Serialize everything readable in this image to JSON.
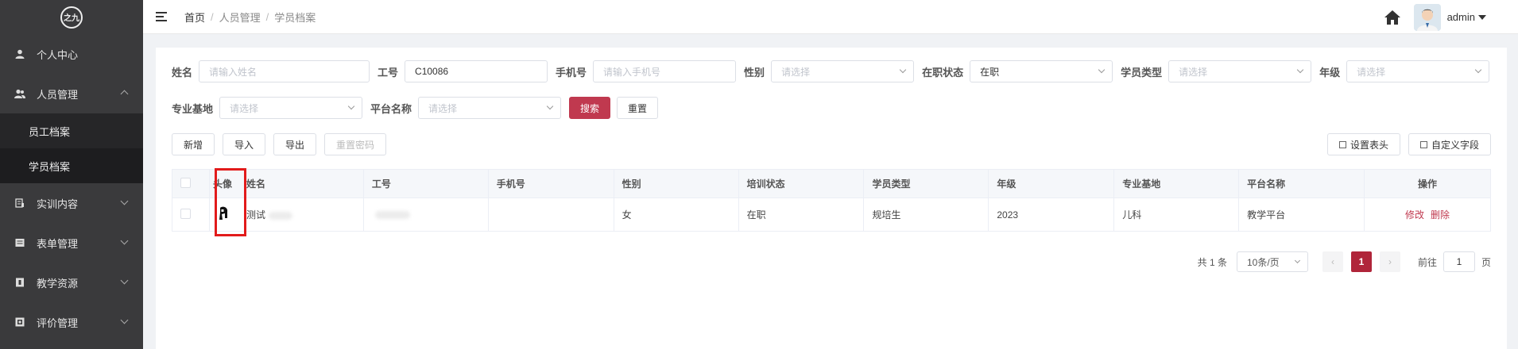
{
  "sidebar": {
    "logo_text": "之九",
    "items": [
      {
        "label": "个人中心"
      },
      {
        "label": "人员管理"
      },
      {
        "label": "实训内容"
      },
      {
        "label": "表单管理"
      },
      {
        "label": "教学资源"
      },
      {
        "label": "评价管理"
      }
    ],
    "sub_items": [
      {
        "label": "员工档案"
      },
      {
        "label": "学员档案"
      }
    ]
  },
  "header": {
    "breadcrumb": [
      "首页",
      "人员管理",
      "学员档案"
    ],
    "separator": "/",
    "username": "admin"
  },
  "filters": {
    "name": {
      "label": "姓名",
      "placeholder": "请输入姓名"
    },
    "emp_no": {
      "label": "工号",
      "value": "C10086"
    },
    "phone": {
      "label": "手机号",
      "placeholder": "请输入手机号"
    },
    "gender": {
      "label": "性别",
      "placeholder": "请选择"
    },
    "status": {
      "label": "在职状态",
      "value": "在职"
    },
    "student_type": {
      "label": "学员类型",
      "placeholder": "请选择"
    },
    "grade": {
      "label": "年级",
      "placeholder": "请选择"
    },
    "base": {
      "label": "专业基地",
      "placeholder": "请选择"
    },
    "platform": {
      "label": "平台名称",
      "placeholder": "请选择"
    },
    "search_label": "搜索",
    "reset_label": "重置"
  },
  "toolbar": {
    "add": "新增",
    "import": "导入",
    "export": "导出",
    "reset_pwd": "重置密码",
    "set_header": "设置表头",
    "custom_field": "自定义字段"
  },
  "table": {
    "columns": [
      "头像",
      "姓名",
      "工号",
      "手机号",
      "性别",
      "培训状态",
      "学员类型",
      "年级",
      "专业基地",
      "平台名称",
      "操作"
    ],
    "rows": [
      {
        "name": "测试",
        "emp_no": "",
        "phone": "",
        "gender": "女",
        "training_status": "在职",
        "student_type": "规培生",
        "grade": "2023",
        "base": "儿科",
        "platform": "教学平台",
        "edit": "修改",
        "delete": "删除"
      }
    ]
  },
  "pagination": {
    "total": "共 1 条",
    "page_size": "10条/页",
    "current_page": "1",
    "prev": "‹",
    "next": "›",
    "goto_label": "前往",
    "goto_value": "1",
    "page_suffix": "页"
  },
  "colors": {
    "accent": "#c0394f",
    "sidebar_bg": "#3a3a3c",
    "highlight": "#e21b1b"
  }
}
